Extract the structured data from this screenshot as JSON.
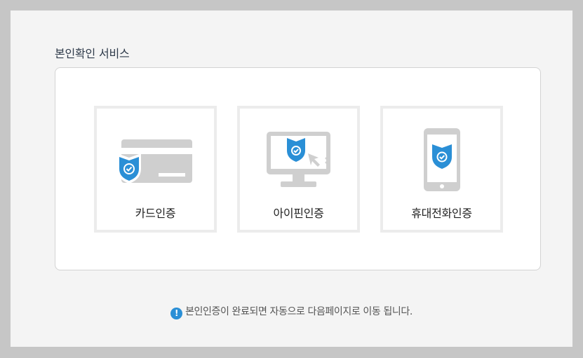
{
  "section": {
    "title": "본인확인 서비스"
  },
  "cards": [
    {
      "label": "카드인증",
      "icon": "credit-card-shield-icon"
    },
    {
      "label": "아이핀인증",
      "icon": "monitor-shield-icon"
    },
    {
      "label": "휴대전화인증",
      "icon": "smartphone-shield-icon"
    }
  ],
  "notice": {
    "icon": "!",
    "text": "본인인증이 완료되면 자동으로 다음페이지로 이동 됩니다."
  },
  "colors": {
    "accent": "#2a8fd6",
    "icon_gray": "#cfcfcf",
    "card_border": "#ececec"
  }
}
